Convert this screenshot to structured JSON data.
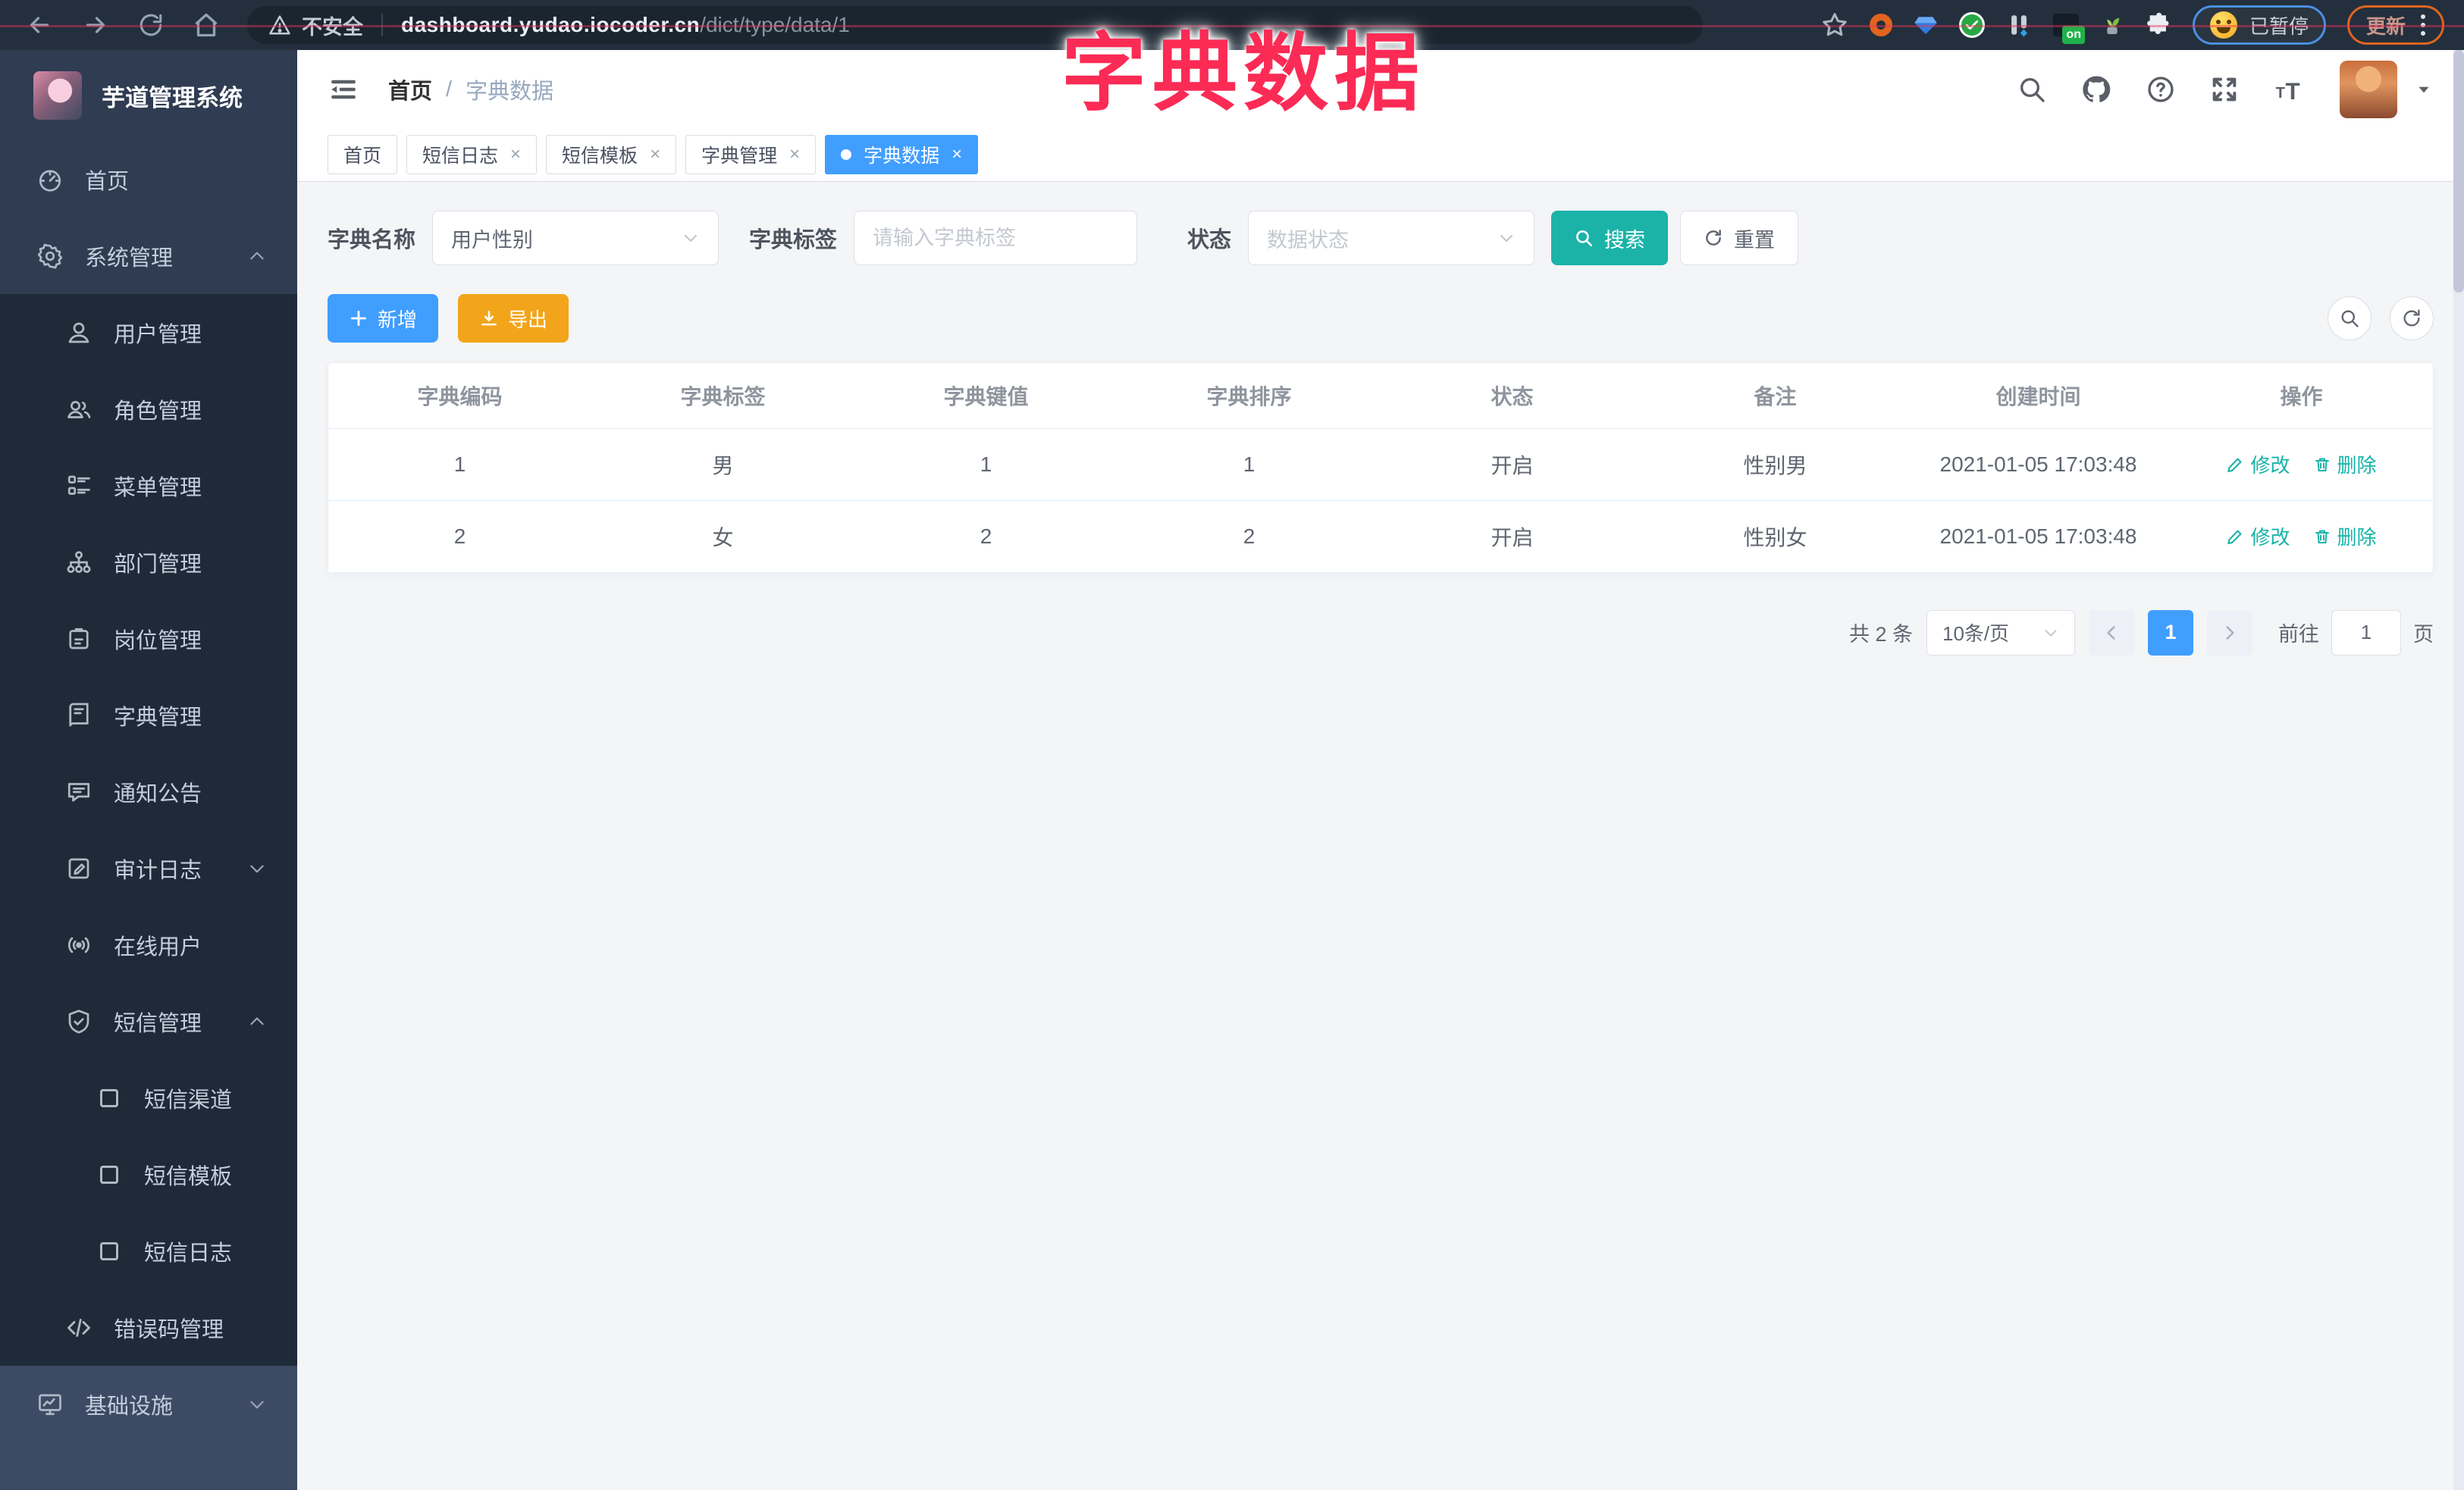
{
  "browser": {
    "insecure_label": "不安全",
    "host": "dashboard.yudao.iocoder.cn",
    "path": "/dict/type/data/1",
    "on_badge": "on",
    "paused_label": "已暂停",
    "update_label": "更新"
  },
  "annotation": {
    "title": "字典数据"
  },
  "sidebar": {
    "title": "芋道管理系统",
    "items": [
      {
        "label": "首页"
      },
      {
        "label": "系统管理"
      },
      {
        "label": "用户管理"
      },
      {
        "label": "角色管理"
      },
      {
        "label": "菜单管理"
      },
      {
        "label": "部门管理"
      },
      {
        "label": "岗位管理"
      },
      {
        "label": "字典管理"
      },
      {
        "label": "通知公告"
      },
      {
        "label": "审计日志"
      },
      {
        "label": "在线用户"
      },
      {
        "label": "短信管理"
      },
      {
        "label": "短信渠道"
      },
      {
        "label": "短信模板"
      },
      {
        "label": "短信日志"
      },
      {
        "label": "错误码管理"
      },
      {
        "label": "基础设施"
      }
    ]
  },
  "header": {
    "breadcrumb_home": "首页",
    "breadcrumb_sep": "/",
    "breadcrumb_current": "字典数据"
  },
  "tabs": [
    {
      "label": "首页"
    },
    {
      "label": "短信日志"
    },
    {
      "label": "短信模板"
    },
    {
      "label": "字典管理"
    },
    {
      "label": "字典数据"
    }
  ],
  "filters": {
    "dict_name_label": "字典名称",
    "dict_name_value": "用户性别",
    "dict_tag_label": "字典标签",
    "dict_tag_placeholder": "请输入字典标签",
    "status_label": "状态",
    "status_placeholder": "数据状态",
    "search_label": "搜索",
    "reset_label": "重置"
  },
  "toolbar": {
    "add_label": "新增",
    "export_label": "导出"
  },
  "table": {
    "headers": [
      "字典编码",
      "字典标签",
      "字典键值",
      "字典排序",
      "状态",
      "备注",
      "创建时间",
      "操作"
    ],
    "rows": [
      {
        "code": "1",
        "tag": "男",
        "value": "1",
        "sort": "1",
        "status": "开启",
        "remark": "性别男",
        "created": "2021-01-05 17:03:48"
      },
      {
        "code": "2",
        "tag": "女",
        "value": "2",
        "sort": "2",
        "status": "开启",
        "remark": "性别女",
        "created": "2021-01-05 17:03:48"
      }
    ],
    "edit_label": "修改",
    "delete_label": "删除"
  },
  "pagination": {
    "total": "共 2 条",
    "page_size": "10条/页",
    "current_page": "1",
    "goto_label": "前往",
    "goto_value": "1",
    "page_unit": "页"
  },
  "colors": {
    "accent": "#409eff",
    "teal": "#1bb3a8",
    "warning": "#f2a51a",
    "annotation": "#fb2b55"
  }
}
